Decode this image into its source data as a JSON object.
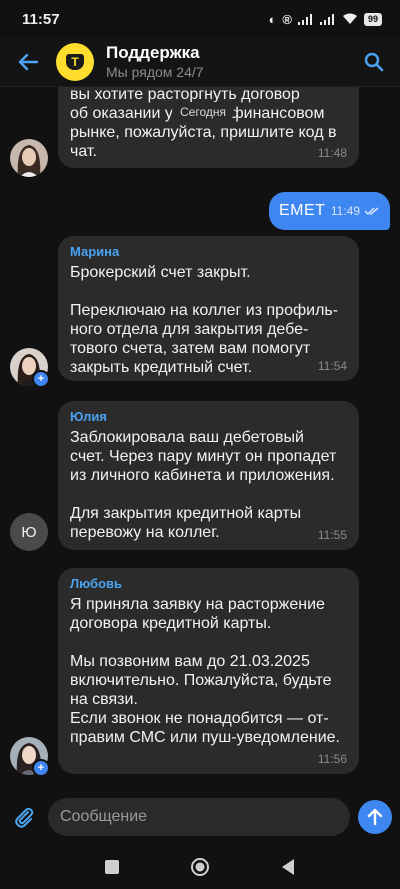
{
  "status_bar": {
    "time": "11:57",
    "icons": [
      "alarm-icon",
      "registered-icon",
      "cell-signal-icon",
      "wifi-icon",
      "battery-icon"
    ],
    "battery": "99"
  },
  "header": {
    "title": "Поддержка",
    "subtitle": "Мы рядом 24/7",
    "logo_letter": "Т",
    "accent": "#ffdd2d"
  },
  "date_divider": "Сегодня",
  "messages": {
    "partial": {
      "text": "вы хотите расторгнуть договор\nоб оказании услуг на финансовом\nрынке, пожалуйста, пришлите код в\nчат.",
      "time": "11:48"
    },
    "outgoing": {
      "text": "ЕМЕТ",
      "time": "11:49"
    },
    "marina": {
      "sender": "Марина",
      "text": "Брокерский счет закрыт.\n\nПереключаю на коллег из профиль-\nного отдела для закрытия дебе-\nтового счета, затем вам помогут\nзакрыть кредитный счет.",
      "time": "11:54"
    },
    "yulia": {
      "sender": "Юлия",
      "avatar_initial": "Ю",
      "text": "Заблокировала ваш дебетовый\nсчет. Через пару минут он пропадет\nиз личного кабинета и приложения.\n\nДля закрытия кредитной карты\nперевожу на коллег.",
      "time": "11:55"
    },
    "lyubov": {
      "sender": "Любовь",
      "text": "Я приняла заявку на расторжение\nдоговора кредитной карты.\n\nМы позвоним вам до 21.03.2025\nвключительно. Пожалуйста, будьте\nна связи.\nЕсли звонок не понадобится — от-\nправим СМС или пуш-уведомление.",
      "time": "11:56"
    }
  },
  "composer": {
    "placeholder": "Сообщение",
    "value": ""
  },
  "colors": {
    "background": "#111111",
    "bubble": "#2b2b2b",
    "outgoing_bubble": "#3e87f0",
    "sender_name": "#4aa3f0"
  }
}
